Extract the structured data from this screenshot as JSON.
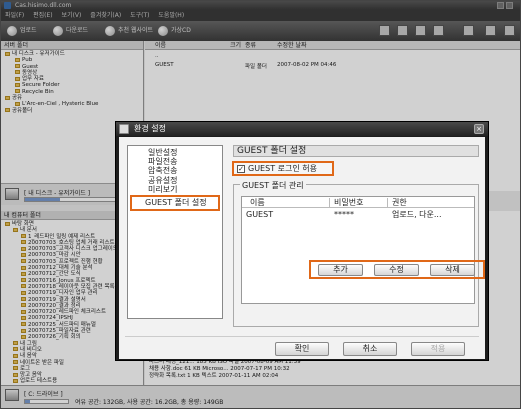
{
  "window": {
    "title": "Cas.hisimo.dll.com"
  },
  "menu": [
    "파일(F)",
    "편집(E)",
    "보기(V)",
    "즐겨찾기(A)",
    "도구(T)",
    "도움말(H)"
  ],
  "toolbar": {
    "upload": "업로드",
    "download": "다운로드",
    "recommend": "추천 웹사이트",
    "gift": "가상CD"
  },
  "left_pane": {
    "header": "서버 폴더",
    "tree": [
      "내 디스크 - 유저가이드",
      "Pub",
      "Guest",
      "동영상",
      "업무 자료",
      "Secure Folder",
      "Recycle Bin",
      "공유",
      "L'Arc-en-Ciel , Hysteric Blue",
      "공유폴더"
    ]
  },
  "right_pane": {
    "columns": [
      "이름",
      "크기",
      "종류",
      "수정한 날짜"
    ],
    "rows": [
      {
        "name": "..",
        "size": "",
        "type": "",
        "date": ""
      },
      {
        "name": "GUEST",
        "size": "",
        "type": "파일 폴더",
        "date": "2007-08-02 PM 04:46"
      }
    ]
  },
  "path_bar": {
    "label": "[ 내 디스크 - 유저가이드 ]",
    "usage_fraction": 0.32
  },
  "lower_left": {
    "header": "내 컴퓨터 폴더",
    "tree": [
      "바탕 화면",
      "내 문서",
      "1_레드파인 밀링 예제 리스트",
      "20070703_호스팅 업체 거래 리스트",
      "20070703_고객사 디스크 업그레이드",
      "20070703_마감 시안",
      "20070703_프로젝트 진행 현황",
      "20070712_대체 기술 분석",
      "20070712_간단 도식",
      "20070716_Jonus 프로젝트",
      "20070718_레이아웃 모집 관련 목록",
      "20070719_디자인 업무 관리",
      "20070719_결과 설명서",
      "20070720_결과 정리",
      "20070720_레드파인 체크리스트",
      "20070724_IPSHJ",
      "20070725_서드파티 매뉴얼",
      "20070725_파일자료 관련",
      "20070726_기획 회의",
      "내 그림",
      "내 비디오",
      "내 음악",
      "네이트온 받은 파일",
      "로그",
      "망고 음악",
      "업로드 테스트용"
    ]
  },
  "lower_right": {
    "rows": [
      {
        "name": "마스터 배정_121...",
        "size": "185 KB",
        "type": "ISO 파일",
        "date": "2007-08-09 AM 11:39"
      },
      {
        "name": "채용 사항.doc",
        "size": "61 KB",
        "type": "Microso...",
        "date": "2007-07-17 PM 10:32"
      },
      {
        "name": "정략화 목록.txt",
        "size": "1 KB",
        "type": "텍스트",
        "date": "2007-01-11 AM 02:04"
      }
    ]
  },
  "status_bar": {
    "drive": "[ C: 드라이브 ]",
    "info": "여유 공간: 132GB, 사용 공간: 16.2GB, 총 용량: 149GB",
    "usage_fraction": 0.11
  },
  "dialog": {
    "title": "환경 설정",
    "nav": [
      "일반설정",
      "파일전송",
      "압축전송",
      "공유설정",
      "미리보기",
      "GUEST 폴더 설정"
    ],
    "selected_nav": "GUEST 폴더 설정",
    "section_title": "GUEST 폴더 설정",
    "allow_login": {
      "label": "GUEST 로그인 허용",
      "checked": true
    },
    "manage_group": "GUEST 폴더 관리",
    "table": {
      "columns": [
        "이름",
        "비밀번호",
        "권한"
      ],
      "rows": [
        {
          "name": "GUEST",
          "password": "*****",
          "permission": "업로드, 다운..."
        }
      ]
    },
    "buttons": {
      "add": "추가",
      "edit": "수정",
      "delete": "삭제"
    },
    "footer": {
      "ok": "확인",
      "cancel": "취소",
      "apply": "적용"
    },
    "accent_color": "#e06818"
  }
}
